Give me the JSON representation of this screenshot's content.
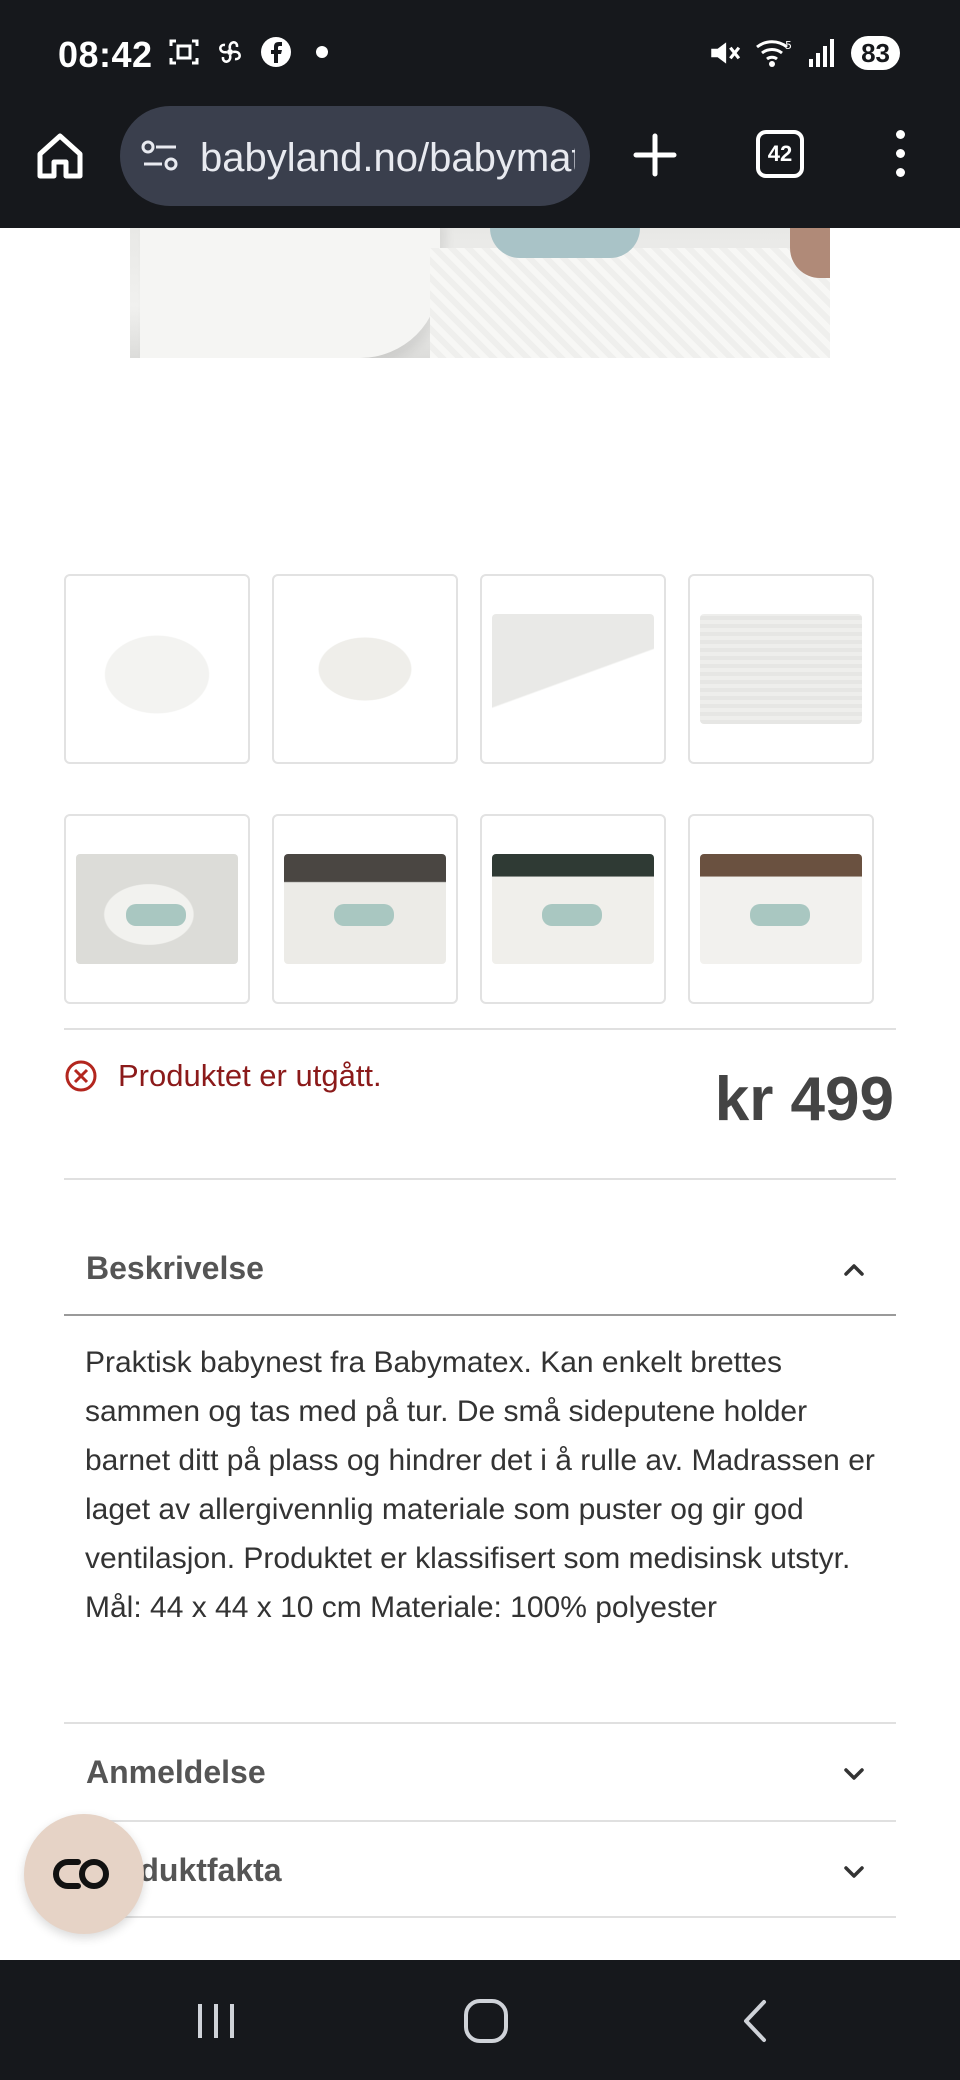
{
  "status_bar": {
    "time": "08:42",
    "battery": "83",
    "icons_left": [
      "screenshot-icon",
      "fan-icon",
      "facebook-icon",
      "dot-icon"
    ],
    "icons_right": [
      "mute-icon",
      "wifi-icon",
      "signal-icon"
    ]
  },
  "browser": {
    "url": "babyland.no/babymatex",
    "tab_count": "42"
  },
  "product": {
    "status_text": "Produktet er utgått.",
    "price": "kr 499",
    "thumbnail_count": 8
  },
  "accordion": {
    "description": {
      "title": "Beskrivelse",
      "expanded": true,
      "body": "Praktisk babynest fra Babymatex. Kan enkelt brettes sammen og tas med på tur. De små sideputene holder barnet ditt på plass og hindrer det i å rulle av. Madrassen er laget av allergivennlig materiale som puster og gir god ventilasjon. Produktet er klassifisert som medisinsk utstyr. Mål: 44 x 44 x 10 cm Materiale: 100% polyester"
    },
    "review": {
      "title": "Anmeldelse",
      "expanded": false
    },
    "facts": {
      "title": "Produktfakta",
      "expanded": false
    }
  },
  "colors": {
    "system_bar": "#16181c",
    "url_box": "#3a3f4d",
    "error_red": "#8b1a1a",
    "chat_button": "#e6d3c6"
  }
}
